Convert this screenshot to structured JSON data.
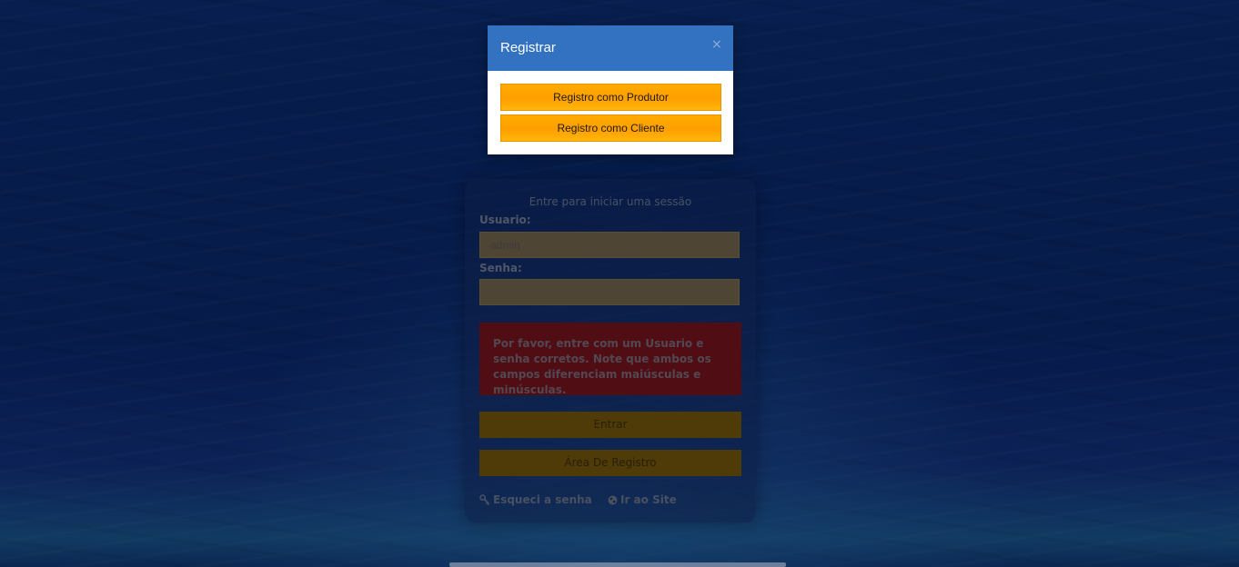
{
  "modal": {
    "title": "Registrar",
    "close_glyph": "×",
    "buttons": [
      {
        "label": "Registro como Produtor"
      },
      {
        "label": "Registro como Cliente"
      }
    ]
  },
  "login": {
    "message": "Entre para iniciar uma sessão",
    "username_label": "Usuario:",
    "username_value": "admin",
    "password_label": "Senha:",
    "password_value": "",
    "error_text": "Por favor, entre com um Usuario e senha corretos. Note que ambos os campos diferenciam maiúsculas e minúsculas.",
    "submit_label": "Entrar",
    "register_label": "Área De Registro",
    "forgot_label": "Esqueci a senha",
    "site_label": "Ir ao Site"
  },
  "icons": {
    "forgot": "key-icon",
    "site": "globe-icon"
  },
  "colors": {
    "modal_header": "#3272c0",
    "button_orange": "#ffa500",
    "error_red": "#7b1414",
    "background_blue": "#0a2b68"
  }
}
